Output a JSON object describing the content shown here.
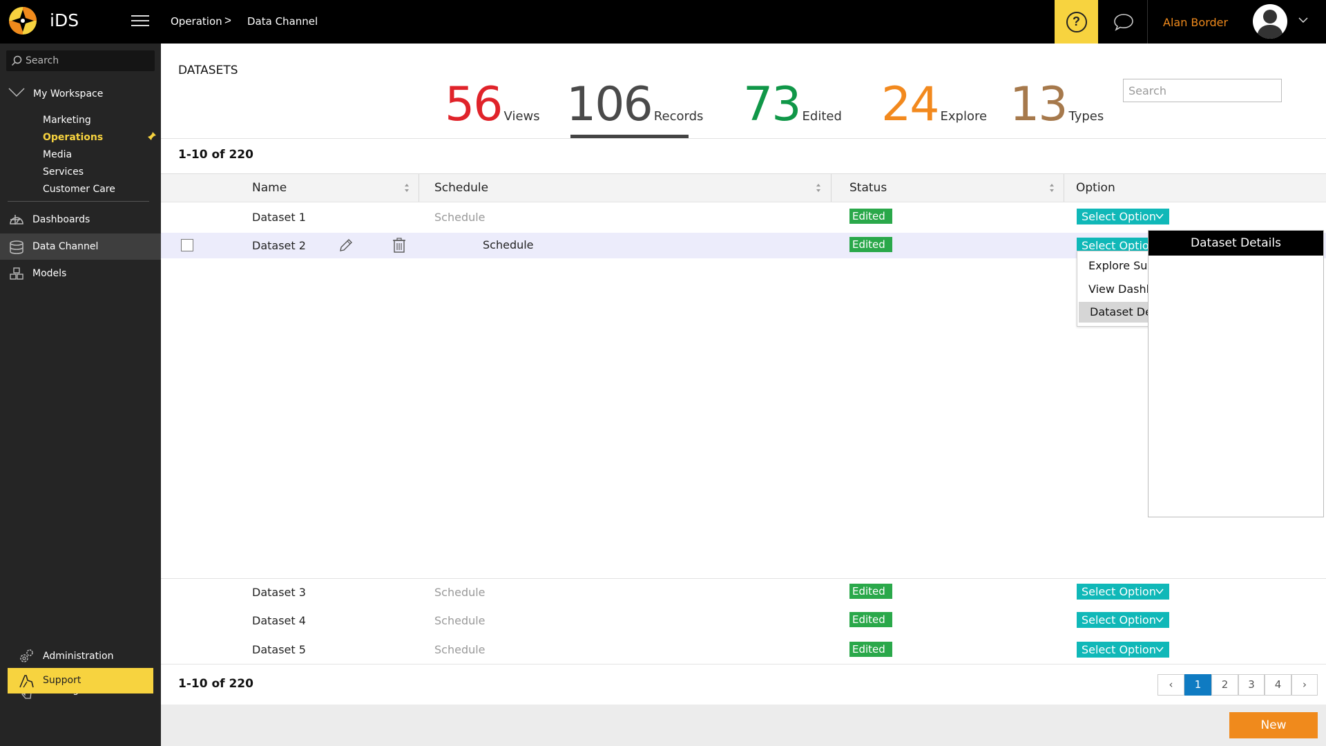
{
  "app": {
    "name": "iDS"
  },
  "breadcrumb": [
    "Operation",
    "Data Channel"
  ],
  "header": {
    "user_name": "Alan Border",
    "help_symbol": "?"
  },
  "sidebar": {
    "search_placeholder": "Search",
    "workspace_label": "My Workspace",
    "workspace_items": [
      {
        "label": "Marketing"
      },
      {
        "label": "Operations",
        "active": true
      },
      {
        "label": "Media"
      },
      {
        "label": "Services"
      },
      {
        "label": "Customer Care"
      }
    ],
    "nav": [
      {
        "label": "Dashboards",
        "icon": "gauge-icon"
      },
      {
        "label": "Data Channel",
        "icon": "database-icon",
        "active": true
      },
      {
        "label": "Models",
        "icon": "cubes-icon"
      }
    ],
    "bottom": [
      {
        "label": "Administration",
        "icon": "gears-icon"
      },
      {
        "label": "Getting Started",
        "icon": "touch-icon"
      },
      {
        "label": "Support",
        "icon": "support-icon"
      }
    ]
  },
  "main": {
    "title": "DATASETS",
    "search_placeholder": "Search",
    "stats": [
      {
        "value": "56",
        "label": "Views",
        "color": "#e0232a"
      },
      {
        "value": "106",
        "label": "Records",
        "color": "#4a4a4a",
        "active": true
      },
      {
        "value": "73",
        "label": "Edited",
        "color": "#109748"
      },
      {
        "value": "24",
        "label": "Explore",
        "color": "#f2891e"
      },
      {
        "value": "13",
        "label": "Types",
        "color": "#a6794c"
      }
    ],
    "range_top": "1-10 of 220",
    "range_bottom": "1-10 of 220",
    "columns": [
      "Name",
      "Schedule",
      "Status",
      "Option"
    ],
    "rows": [
      {
        "name": "Dataset 1",
        "schedule": "Schedule",
        "status": "Edited",
        "option": "Select Option"
      },
      {
        "name": "Dataset 2",
        "schedule": "Schedule",
        "status": "Edited",
        "option": "Select Option"
      },
      {
        "name": "Dataset 3",
        "schedule": "Schedule",
        "status": "Edited",
        "option": "Select Option"
      },
      {
        "name": "Dataset 4",
        "schedule": "Schedule",
        "status": "Edited",
        "option": "Select Option"
      },
      {
        "name": "Dataset 5",
        "schedule": "Schedule",
        "status": "Edited",
        "option": "Select Option"
      }
    ],
    "option_menu": [
      "Explore Sub",
      "View Dashb",
      "Dataset Deta"
    ],
    "details_title": "Dataset Details",
    "pagination": {
      "prev": "‹",
      "pages": [
        "1",
        "2",
        "3",
        "4"
      ],
      "current": "1",
      "next": "›"
    },
    "new_button": "New"
  },
  "colors": {
    "accent_yellow": "#f7d33f",
    "status_green": "#2aa84a",
    "option_teal": "#10b8b8",
    "new_orange": "#f08a1c",
    "page_blue": "#0f7bc2"
  }
}
